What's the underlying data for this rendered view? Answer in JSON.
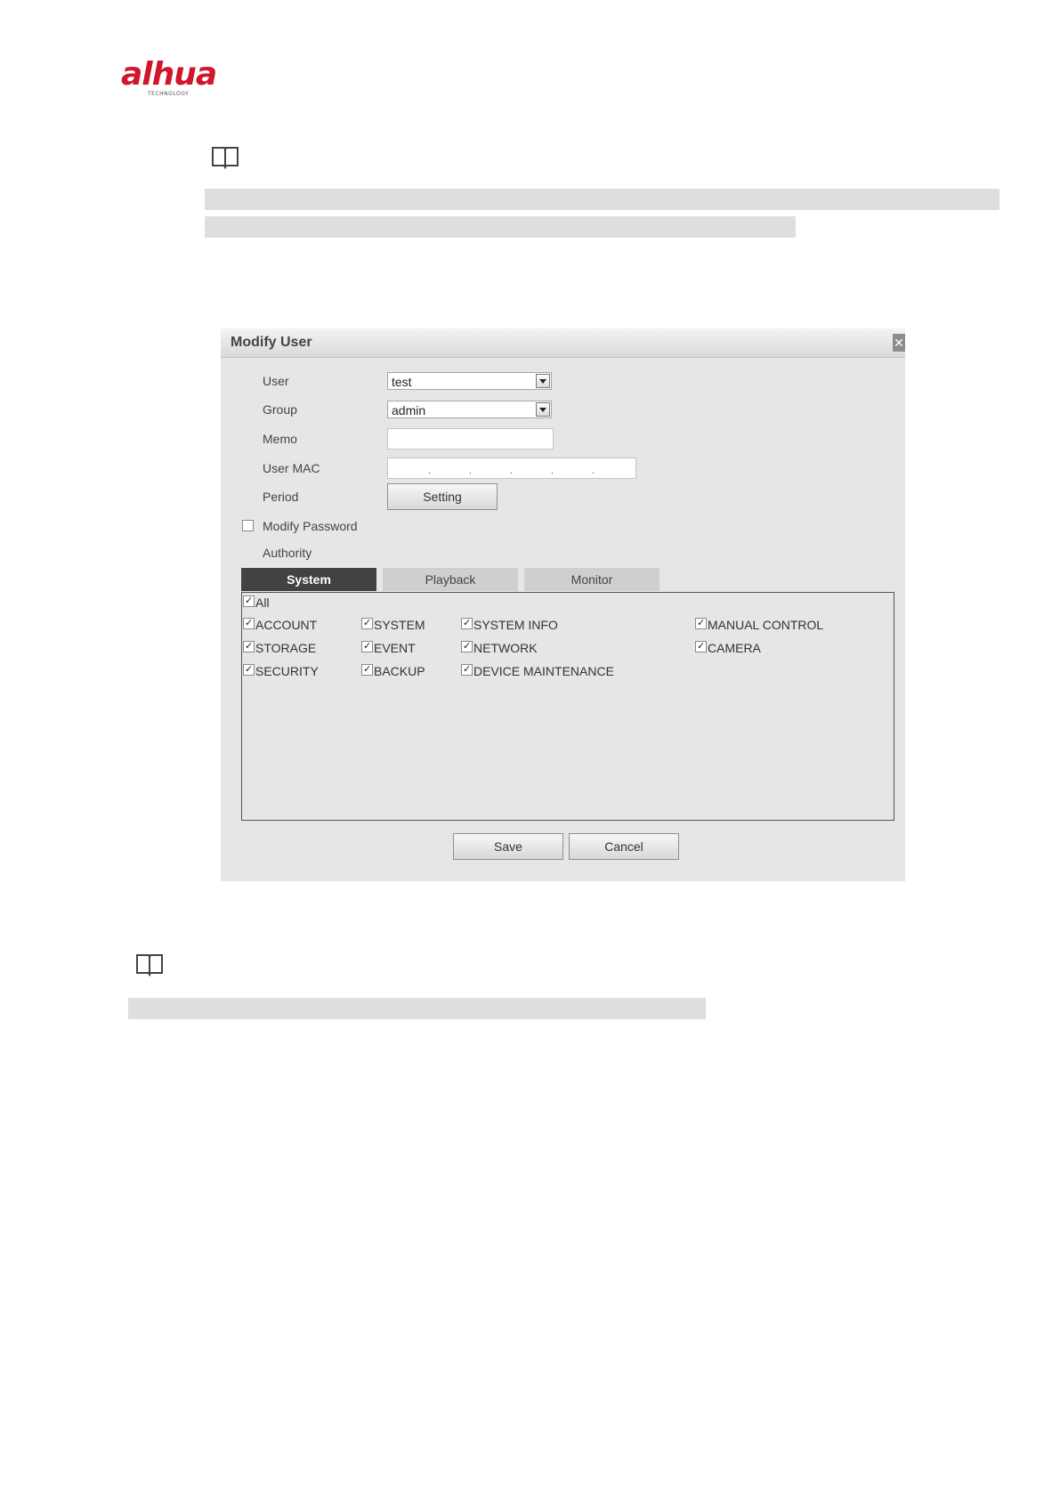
{
  "logo": {
    "brand": "alhua",
    "subtitle": "TECHNOLOGY"
  },
  "dialog": {
    "title": "Modify User",
    "fields": {
      "user_label": "User",
      "user_value": "test",
      "group_label": "Group",
      "group_value": "admin",
      "memo_label": "Memo",
      "memo_value": "",
      "user_mac_label": "User MAC",
      "period_label": "Period",
      "setting_button": "Setting",
      "modify_password_label": "Modify Password",
      "modify_password_checked": false,
      "authority_label": "Authority"
    },
    "tabs": [
      {
        "label": "System",
        "active": true
      },
      {
        "label": "Playback",
        "active": false
      },
      {
        "label": "Monitor",
        "active": false
      }
    ],
    "permissions": {
      "all": {
        "label": "All",
        "checked": true
      },
      "items": [
        {
          "label": "ACCOUNT",
          "checked": true
        },
        {
          "label": "SYSTEM",
          "checked": true
        },
        {
          "label": "SYSTEM INFO",
          "checked": true
        },
        {
          "label": "MANUAL CONTROL",
          "checked": true
        },
        {
          "label": "STORAGE",
          "checked": true
        },
        {
          "label": "EVENT",
          "checked": true
        },
        {
          "label": "NETWORK",
          "checked": true
        },
        {
          "label": "CAMERA",
          "checked": true
        },
        {
          "label": "SECURITY",
          "checked": true
        },
        {
          "label": "BACKUP",
          "checked": true
        },
        {
          "label": "DEVICE MAINTENANCE",
          "checked": true
        }
      ]
    },
    "buttons": {
      "save": "Save",
      "cancel": "Cancel"
    }
  },
  "colors": {
    "brand_red": "#d0152d",
    "active_tab": "#424242",
    "dialog_bg": "#e6e6e6"
  },
  "icons": {
    "note": "book-note-icon",
    "close": "close-icon",
    "dropdown": "chevron-down-icon"
  }
}
